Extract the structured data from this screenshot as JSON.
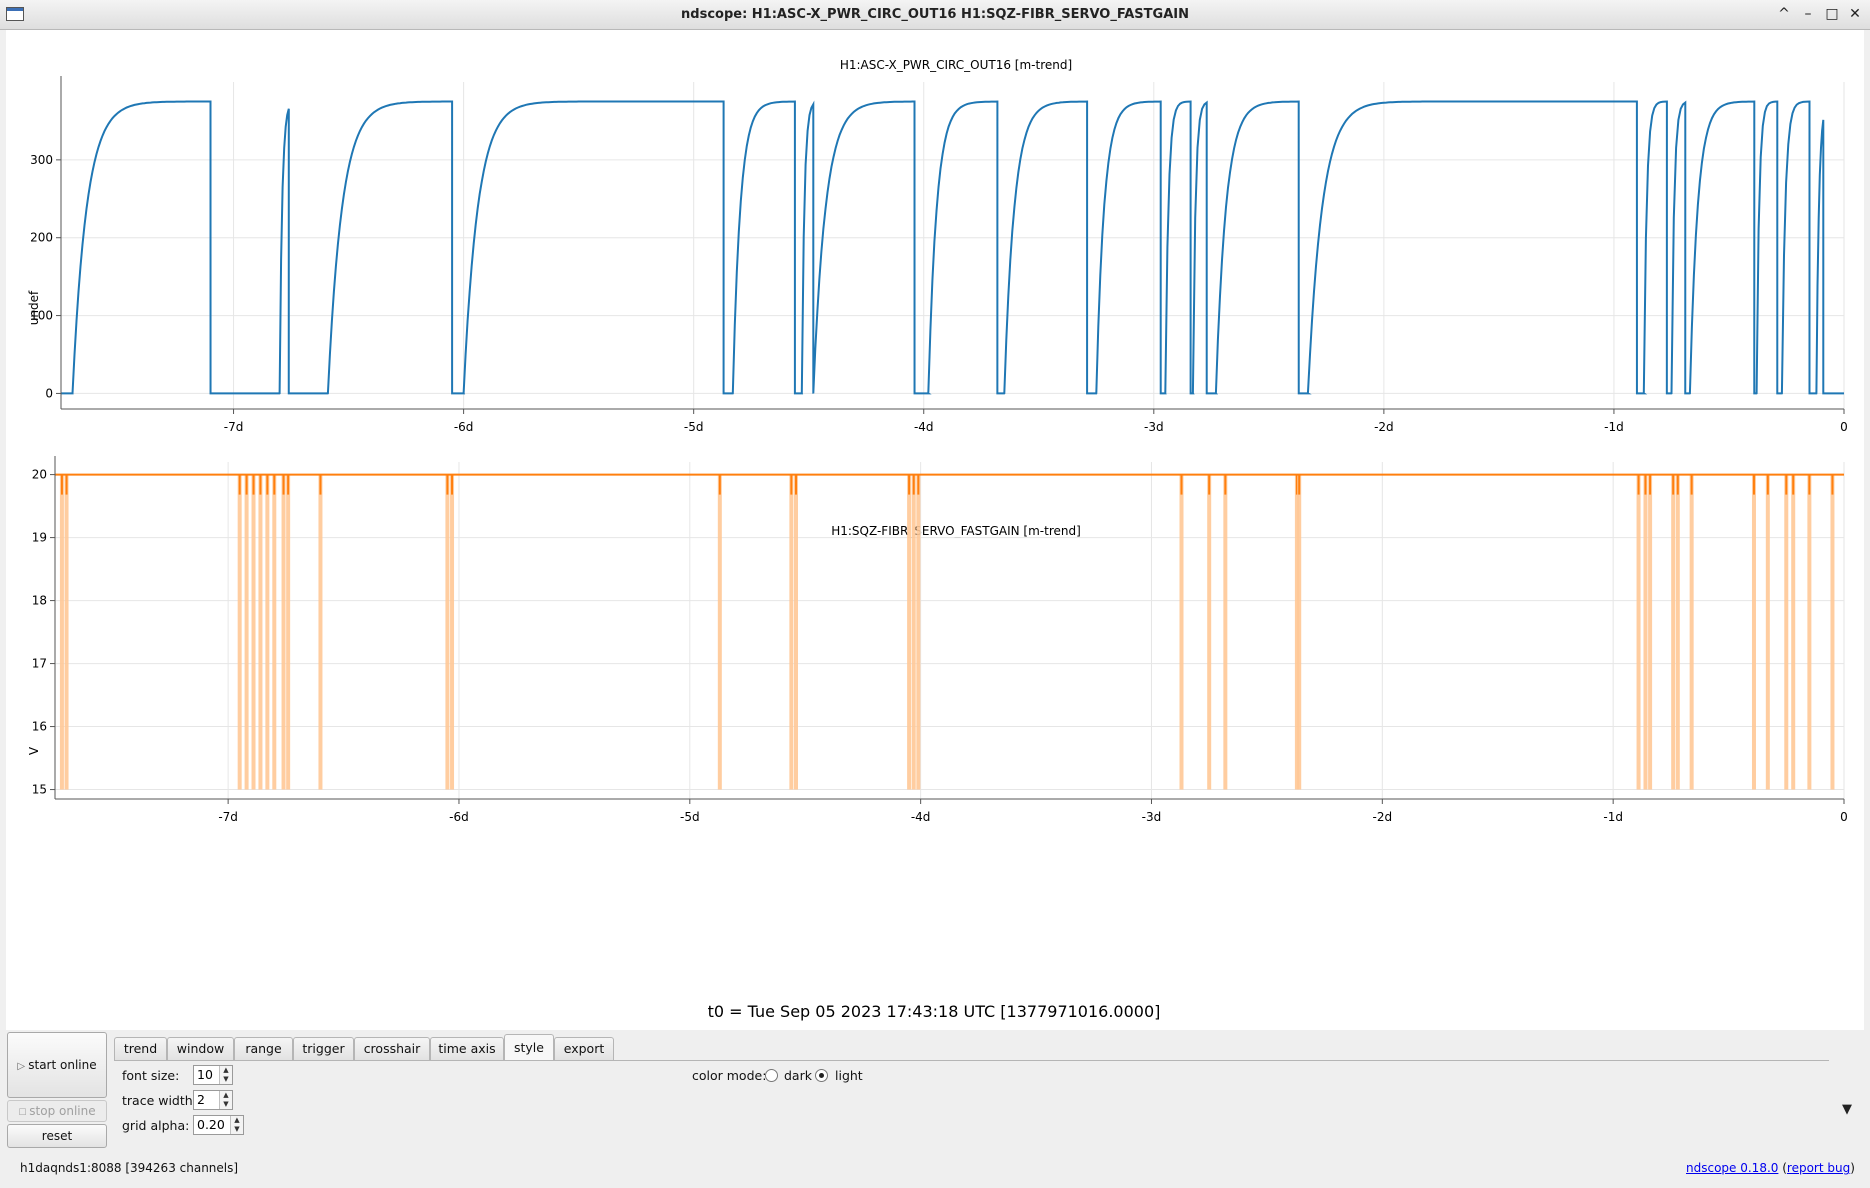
{
  "window": {
    "title": "ndscope: H1:ASC-X_PWR_CIRC_OUT16 H1:SQZ-FIBR_SERVO_FASTGAIN",
    "controls": [
      "^",
      "–",
      "□",
      "✕"
    ]
  },
  "plots": [
    {
      "title": "H1:ASC-X_PWR_CIRC_OUT16 [m-trend]",
      "ylabel": "undef",
      "color": "#1f77b4",
      "yticks": [
        "0",
        "100",
        "200",
        "300"
      ],
      "xticks": [
        "-7d",
        "-6d",
        "-5d",
        "-4d",
        "-3d",
        "-2d",
        "-1d",
        "0"
      ]
    },
    {
      "title": "H1:SQZ-FIBR_SERVO_FASTGAIN [m-trend]",
      "ylabel": "V",
      "color": "#ff7f0e",
      "yticks": [
        "15",
        "16",
        "17",
        "18",
        "19",
        "20"
      ],
      "xticks": [
        "-7d",
        "-6d",
        "-5d",
        "-4d",
        "-3d",
        "-2d",
        "-1d",
        "0"
      ]
    }
  ],
  "chart_data": [
    {
      "type": "line",
      "title": "H1:ASC-X_PWR_CIRC_OUT16 [m-trend]",
      "xlabel": "",
      "ylabel": "undef",
      "xlim": [
        -7.75,
        0
      ],
      "ylim": [
        -20,
        400
      ],
      "grid": true,
      "series": [
        {
          "name": "H1:ASC-X_PWR_CIRC_OUT16",
          "locks": [
            [
              -7.7,
              -7.1
            ],
            [
              -6.8,
              -6.76
            ],
            [
              -6.59,
              -6.05
            ],
            [
              -6.0,
              -4.87
            ],
            [
              -4.83,
              -4.56
            ],
            [
              -4.53,
              -4.48
            ],
            [
              -4.48,
              -4.04
            ],
            [
              -3.98,
              -3.68
            ],
            [
              -3.65,
              -3.29
            ],
            [
              -3.25,
              -2.97
            ],
            [
              -2.95,
              -2.84
            ],
            [
              -2.83,
              -2.77
            ],
            [
              -2.73,
              -2.37
            ],
            [
              -2.33,
              -0.9
            ],
            [
              -0.87,
              -0.77
            ],
            [
              -0.75,
              -0.69
            ],
            [
              -0.67,
              -0.39
            ],
            [
              -0.38,
              -0.29
            ],
            [
              -0.27,
              -0.15
            ],
            [
              -0.12,
              -0.09
            ]
          ],
          "high_level": 375,
          "low_level": 0
        }
      ]
    },
    {
      "type": "line",
      "title": "H1:SQZ-FIBR_SERVO_FASTGAIN [m-trend]",
      "xlabel": "",
      "ylabel": "V",
      "xlim": [
        -7.75,
        0
      ],
      "ylim": [
        14.85,
        20.2
      ],
      "grid": true,
      "series": [
        {
          "name": "H1:SQZ-FIBR_SERVO_FASTGAIN",
          "baseline": 20,
          "dips": [
            [
              -7.72,
              15.0
            ],
            [
              -7.7,
              15.0
            ],
            [
              -6.95,
              15.0
            ],
            [
              -6.92,
              15.0
            ],
            [
              -6.89,
              15.0
            ],
            [
              -6.86,
              15.0
            ],
            [
              -6.83,
              15.0
            ],
            [
              -6.8,
              15.0
            ],
            [
              -6.76,
              15.0
            ],
            [
              -6.74,
              15.0
            ],
            [
              -6.6,
              15.0
            ],
            [
              -6.05,
              15.0
            ],
            [
              -6.03,
              15.0
            ],
            [
              -4.87,
              15.0
            ],
            [
              -4.56,
              15.0
            ],
            [
              -4.54,
              15.0
            ],
            [
              -4.05,
              15.0
            ],
            [
              -4.03,
              15.0
            ],
            [
              -4.01,
              15.0
            ],
            [
              -2.87,
              15.0
            ],
            [
              -2.75,
              15.0
            ],
            [
              -2.68,
              15.0
            ],
            [
              -2.37,
              15.0
            ],
            [
              -2.36,
              15.0
            ],
            [
              -0.89,
              15.0
            ],
            [
              -0.86,
              15.0
            ],
            [
              -0.84,
              15.0
            ],
            [
              -0.74,
              15.0
            ],
            [
              -0.72,
              15.0
            ],
            [
              -0.66,
              15.0
            ],
            [
              -0.39,
              15.0
            ],
            [
              -0.33,
              15.0
            ],
            [
              -0.25,
              15.0
            ],
            [
              -0.22,
              15.0
            ],
            [
              -0.15,
              15.0
            ],
            [
              -0.05,
              15.0
            ]
          ]
        }
      ]
    }
  ],
  "t0_label": "t0 = Tue Sep 05 2023 17:43:18 UTC [1377971016.0000]",
  "controls": {
    "start_online": "start online",
    "stop_online": "stop online",
    "reset": "reset",
    "tabs": [
      "trend",
      "window",
      "range",
      "trigger",
      "crosshair",
      "time axis",
      "style",
      "export"
    ],
    "active_tab": "style",
    "font_size_label": "font size:",
    "font_size_value": "10",
    "trace_width_label": "trace width:",
    "trace_width_value": "2",
    "grid_alpha_label": "grid alpha:",
    "grid_alpha_value": "0.20",
    "color_mode_label": "color mode:",
    "color_mode_dark": "dark",
    "color_mode_light": "light",
    "selected_color_mode": "light"
  },
  "status": {
    "server": "h1daqnds1:8088  [394263 channels]",
    "version": "ndscope 0.18.0",
    "report_bug": "report bug"
  }
}
